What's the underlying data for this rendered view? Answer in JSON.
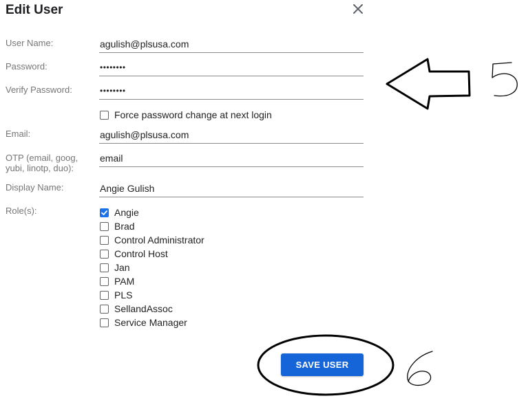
{
  "dialog": {
    "title": "Edit User",
    "close_icon": "close-icon"
  },
  "form": {
    "user_name": {
      "label": "User Name:",
      "value": "agulish@plsusa.com"
    },
    "password": {
      "label": "Password:",
      "value": "••••••••"
    },
    "verify_password": {
      "label": "Verify Password:",
      "value": "••••••••"
    },
    "force_change": {
      "label": "Force password change at next login",
      "checked": false
    },
    "email": {
      "label": "Email:",
      "value": "agulish@plsusa.com"
    },
    "otp": {
      "label_line1": "OTP (email, goog,",
      "label_line2": "yubi, linotp, duo):",
      "value": "email"
    },
    "display_name": {
      "label": "Display Name:",
      "value": "Angie Gulish"
    },
    "roles_label": "Role(s):",
    "roles": [
      {
        "label": "Angie",
        "checked": true
      },
      {
        "label": "Brad",
        "checked": false
      },
      {
        "label": "Control Administrator",
        "checked": false
      },
      {
        "label": "Control Host",
        "checked": false
      },
      {
        "label": "Jan",
        "checked": false
      },
      {
        "label": "PAM",
        "checked": false
      },
      {
        "label": "PLS",
        "checked": false
      },
      {
        "label": "SellandAssoc",
        "checked": false
      },
      {
        "label": "Service Manager",
        "checked": false
      }
    ]
  },
  "actions": {
    "save_label": "SAVE USER"
  },
  "annotations": {
    "arrow_icon": "left-arrow-annotation-icon",
    "step_5": "5",
    "step_6": "6",
    "circle_color": "#000000"
  },
  "colors": {
    "accent": "#1565d8",
    "checkbox_checked": "#1a73e8",
    "label": "#757575"
  }
}
